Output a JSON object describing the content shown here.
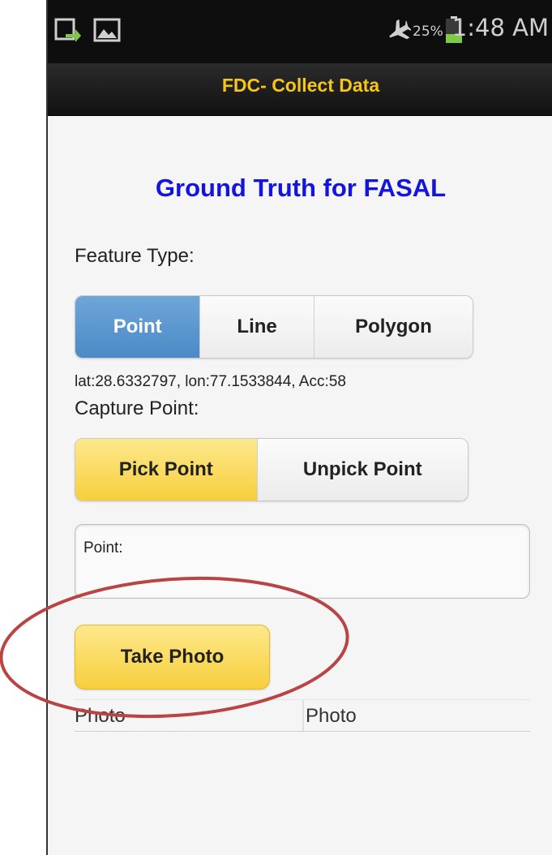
{
  "status_bar": {
    "battery_percent": "25%",
    "time": "1:48 AM",
    "icons": [
      "notification-app-icon",
      "image-icon",
      "airplane-mode-icon",
      "battery-icon"
    ]
  },
  "app_bar": {
    "title": "FDC- Collect Data"
  },
  "main": {
    "heading": "Ground Truth for FASAL",
    "feature_type_label": "Feature Type:",
    "feature_types": [
      "Point",
      "Line",
      "Polygon"
    ],
    "selected_feature_type": "Point",
    "location_readout": "lat:28.6332797, lon:77.1533844, Acc:58",
    "capture_point_label": "Capture Point:",
    "capture_actions": [
      "Pick Point",
      "Unpick Point"
    ],
    "selected_capture_action": "Pick Point",
    "point_field_label": "Point:",
    "take_photo_label": "Take Photo",
    "photo_columns": [
      "Photo",
      "Photo"
    ]
  },
  "colors": {
    "heading": "#1414e0",
    "title": "#f5c518",
    "selected_segment": "#4a8ac6",
    "highlight_button": "#f7cf3c",
    "annotation": "#b84444"
  }
}
